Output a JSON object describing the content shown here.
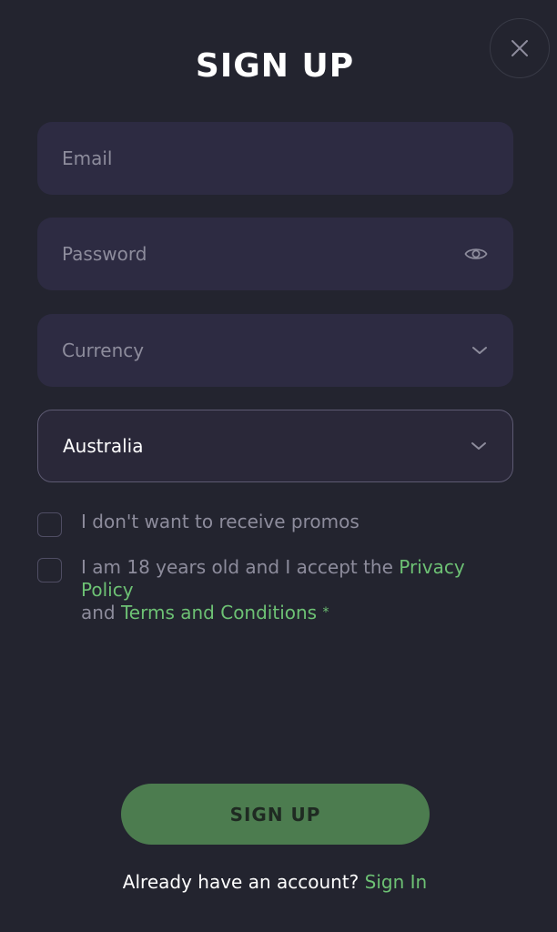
{
  "title": "SIGN UP",
  "close": {
    "icon": "close-icon"
  },
  "fields": {
    "email": {
      "placeholder": "Email"
    },
    "password": {
      "placeholder": "Password",
      "icon": "eye-icon"
    },
    "currency": {
      "placeholder": "Currency",
      "icon": "chevron-down-icon"
    },
    "country": {
      "value": "Australia",
      "icon": "chevron-down-icon"
    }
  },
  "checkboxes": {
    "promos": {
      "label": "I don't want to receive promos",
      "checked": false
    },
    "age": {
      "text_before": "I am 18 years old and I accept the ",
      "privacy_link": "Privacy Policy",
      "text_mid": "and ",
      "terms_link": "Terms and Conditions",
      "required_mark": "*",
      "checked": false
    }
  },
  "submit_label": "SIGN UP",
  "footer": {
    "text": "Already have an account? ",
    "link": "Sign In"
  },
  "colors": {
    "background": "#23242f",
    "field": "#2d2b42",
    "accent": "#6dc174",
    "button": "#4c7c4f"
  }
}
